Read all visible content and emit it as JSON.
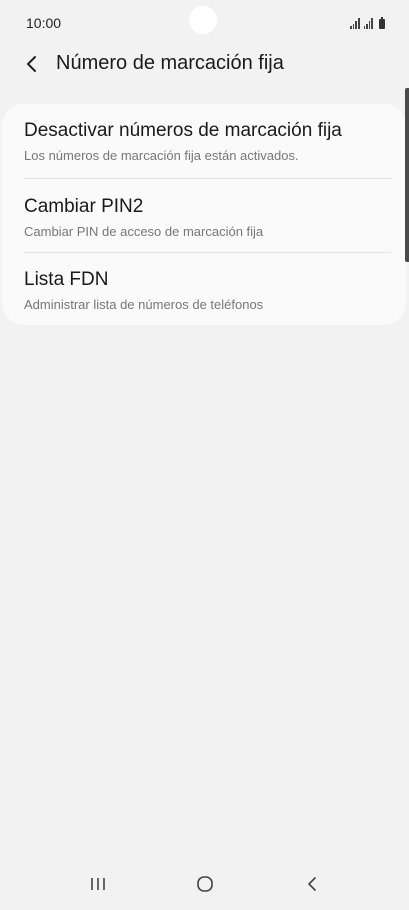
{
  "status_bar": {
    "time": "10:00"
  },
  "header": {
    "back_icon": "chevron-left-icon",
    "title": "Número de marcación fija"
  },
  "settings": {
    "items": [
      {
        "title": "Desactivar números de marcación fija",
        "subtitle": "Los números de marcación fija están activados."
      },
      {
        "title": "Cambiar PIN2",
        "subtitle": "Cambiar PIN de acceso de marcación fija"
      },
      {
        "title": "Lista FDN",
        "subtitle": "Administrar lista de números de teléfonos"
      }
    ]
  },
  "nav_bar": {
    "recents_icon": "recent-apps-icon",
    "home_icon": "home-icon",
    "back_icon": "back-icon"
  }
}
